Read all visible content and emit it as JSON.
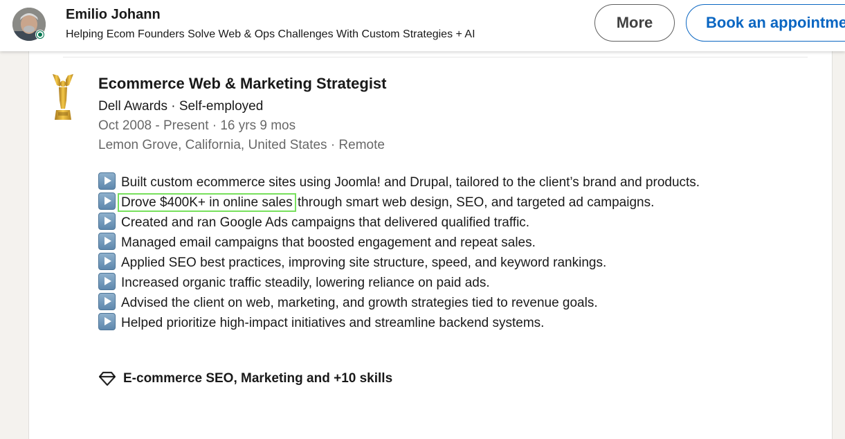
{
  "header": {
    "name": "Emilio Johann",
    "headline": "Helping Ecom Founders Solve Web & Ops Challenges With Custom Strategies + AI",
    "more_label": "More",
    "book_label": "Book an appointment",
    "avatar_icon": "profile-photo",
    "status": "online"
  },
  "experience": {
    "title": "Ecommerce Web & Marketing Strategist",
    "company_line": "Dell Awards · Self-employed",
    "dates_line": "Oct 2008 - Present · 16 yrs 9 mos",
    "location_line": "Lemon Grove, California, United States · Remote",
    "logo_icon": "trophy-icon",
    "bullets": [
      {
        "text": "Built custom ecommerce sites using Joomla! and Drupal, tailored to the client’s brand and products."
      },
      {
        "highlight": "Drove $400K+ in online sales",
        "text": " through smart web design, SEO, and targeted ad campaigns."
      },
      {
        "text": "Created and ran Google Ads campaigns that delivered qualified traffic."
      },
      {
        "text": "Managed email campaigns that boosted engagement and repeat sales."
      },
      {
        "text": "Applied SEO best practices, improving site structure, speed, and keyword rankings."
      },
      {
        "text": "Increased organic traffic steadily, lowering reliance on paid ads."
      },
      {
        "text": "Advised the client on web, marketing, and growth strategies tied to revenue goals."
      },
      {
        "text": "Helped prioritize high-impact initiatives and streamline backend systems."
      }
    ],
    "skills_label": "E-commerce SEO, Marketing and +10 skills",
    "skills_icon": "diamond-icon"
  },
  "colors": {
    "brand_blue": "#0a66c2",
    "highlight_green": "#77e05c",
    "online_green": "#01754f"
  }
}
